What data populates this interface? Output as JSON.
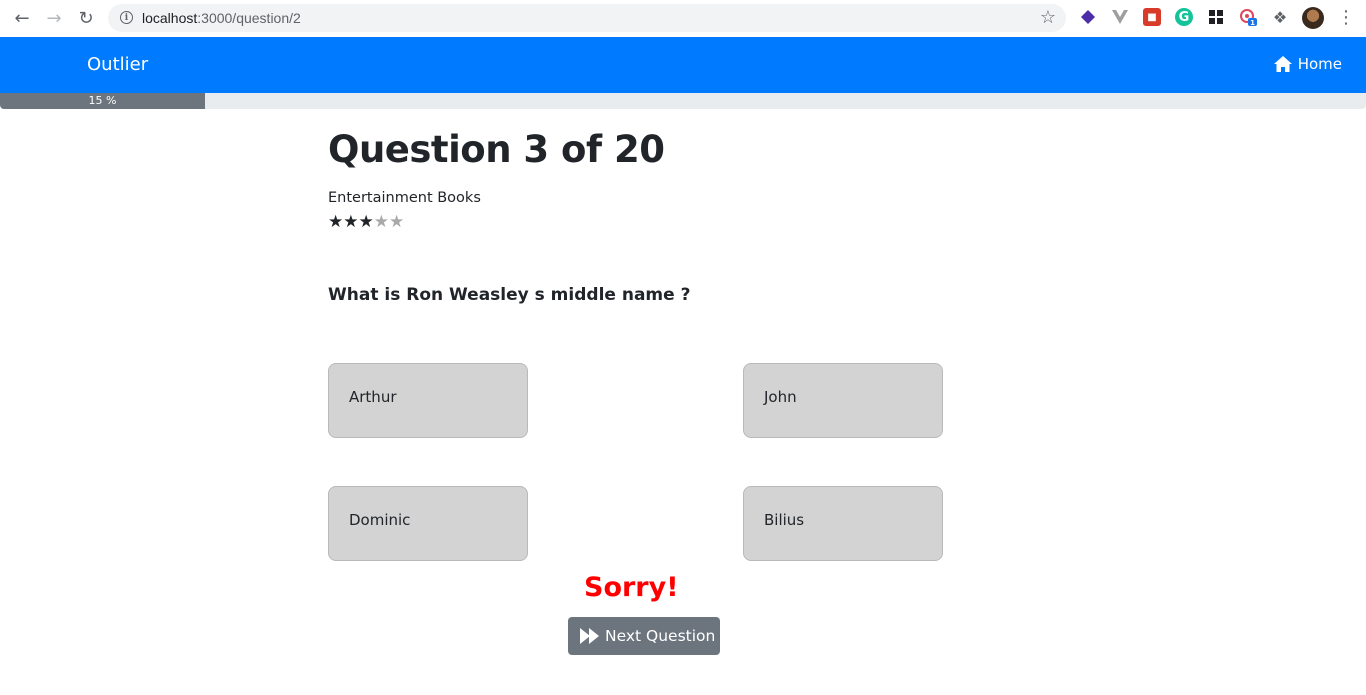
{
  "browser": {
    "url_host": "localhost",
    "url_path": ":3000/question/2",
    "ext_badge": "1"
  },
  "navbar": {
    "brand": "Outlier",
    "home_label": "Home"
  },
  "progress": {
    "label": "15 %",
    "percent": 15
  },
  "quiz": {
    "title": "Question 3 of 20",
    "category": "Entertainment Books",
    "difficulty_stars": {
      "filled": 3,
      "total": 5
    },
    "question": "What is Ron Weasley s middle name ?",
    "answers": [
      "Arthur",
      "John",
      "Dominic",
      "Bilius"
    ],
    "result": "Sorry!",
    "next_label": "Next Question"
  },
  "colors": {
    "primary": "#007bff",
    "secondary": "#6c757d",
    "answer_bg": "#d3d3d3",
    "error": "#ff0000"
  }
}
